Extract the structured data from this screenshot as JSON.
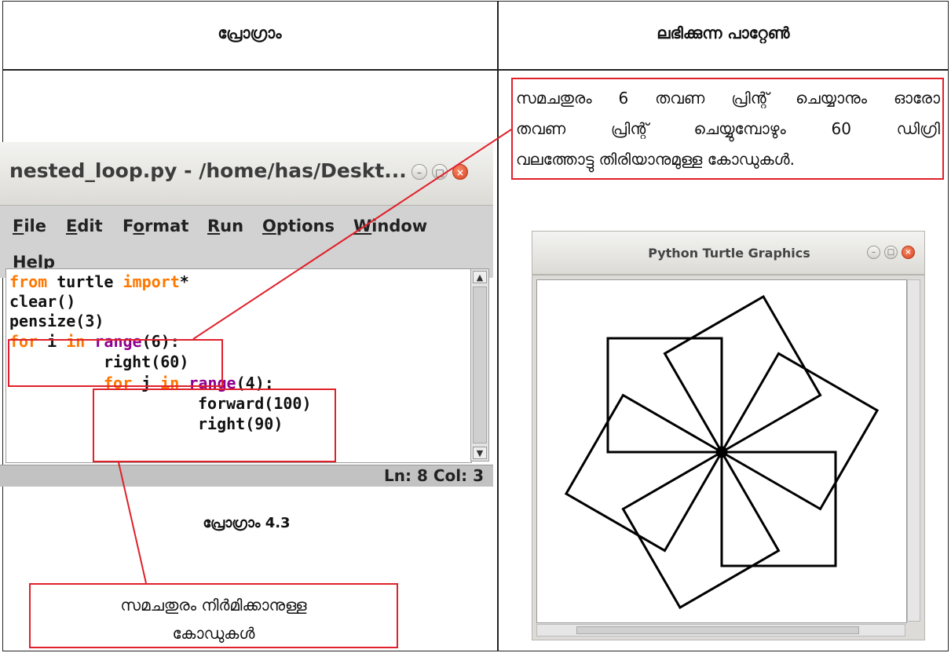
{
  "headers": {
    "program": "പ്രോഗ്രാം",
    "pattern": "ലഭിക്കുന്ന പാറ്റേൺ"
  },
  "idle": {
    "title": "nested_loop.py - /home/has/Deskt...",
    "menu": [
      "File",
      "Edit",
      "Format",
      "Run",
      "Options",
      "Window",
      "Help"
    ],
    "code": {
      "l1a": "from",
      "l1b": " turtle ",
      "l1c": "import",
      "l1d": "*",
      "l2": "clear()",
      "l3": "pensize(3)",
      "l4a": "for",
      "l4b": " i ",
      "l4c": "in",
      "l4d": " ",
      "l4e": "range",
      "l4f": "(6):",
      "l5": "right(60)",
      "l6a": "for",
      "l6b": " j ",
      "l6c": "in",
      "l6d": " ",
      "l6e": "range",
      "l6f": "(4):",
      "l7": "forward(100)",
      "l8": "right(90)"
    },
    "status": "Ln: 8  Col: 3"
  },
  "caption": "പ്രോഗ്രാം 4.3",
  "note_square_code": {
    "line1": "സമചതുരം നിർമിക്കാനുള്ള",
    "line2": "കോഡുകൾ"
  },
  "note_repeat": {
    "line1": "സമചതുരം 6 തവണ പ്രിന്റ് ചെയ്യാനും ഓരോ",
    "line2": "തവണ പ്രിന്റ് ചെയ്യുമ്പോഴും 60 ഡിഗ്രി",
    "line3": "വലത്തോട്ടു തിരിയാനുമുള്ള കോഡുകൾ."
  },
  "turtle": {
    "title": "Python Turtle Graphics",
    "squares": 6,
    "turn_deg": 60
  },
  "colors": {
    "annotation": "#e0202a",
    "keyword": "#ff7700",
    "builtin": "#900090"
  }
}
